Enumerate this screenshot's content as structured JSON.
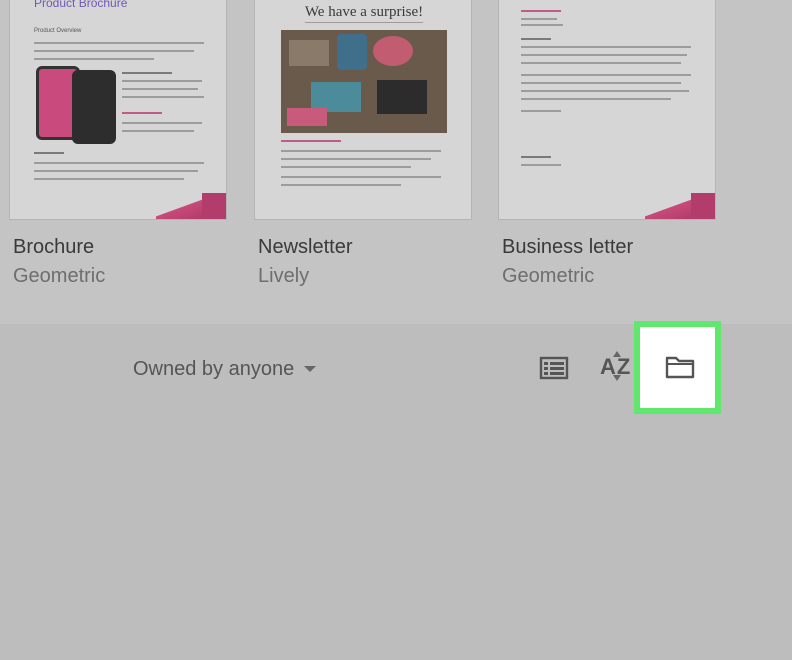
{
  "templates": [
    {
      "name": "Brochure",
      "style": "Geometric",
      "preview": {
        "title": "Product Brochure",
        "heading": "Product Overview"
      }
    },
    {
      "name": "Newsletter",
      "style": "Lively",
      "preview": {
        "title": "We have a surprise!"
      }
    },
    {
      "name": "Business letter",
      "style": "Geometric"
    }
  ],
  "toolbar": {
    "owner_filter": "Owned by anyone",
    "list_view_icon": "list-view-icon",
    "sort_icon": "sort-az-icon",
    "sort_label": "AZ",
    "folder_icon": "folder-icon"
  },
  "colors": {
    "highlight": "#5fe86d",
    "accent": "#c64a7a"
  }
}
